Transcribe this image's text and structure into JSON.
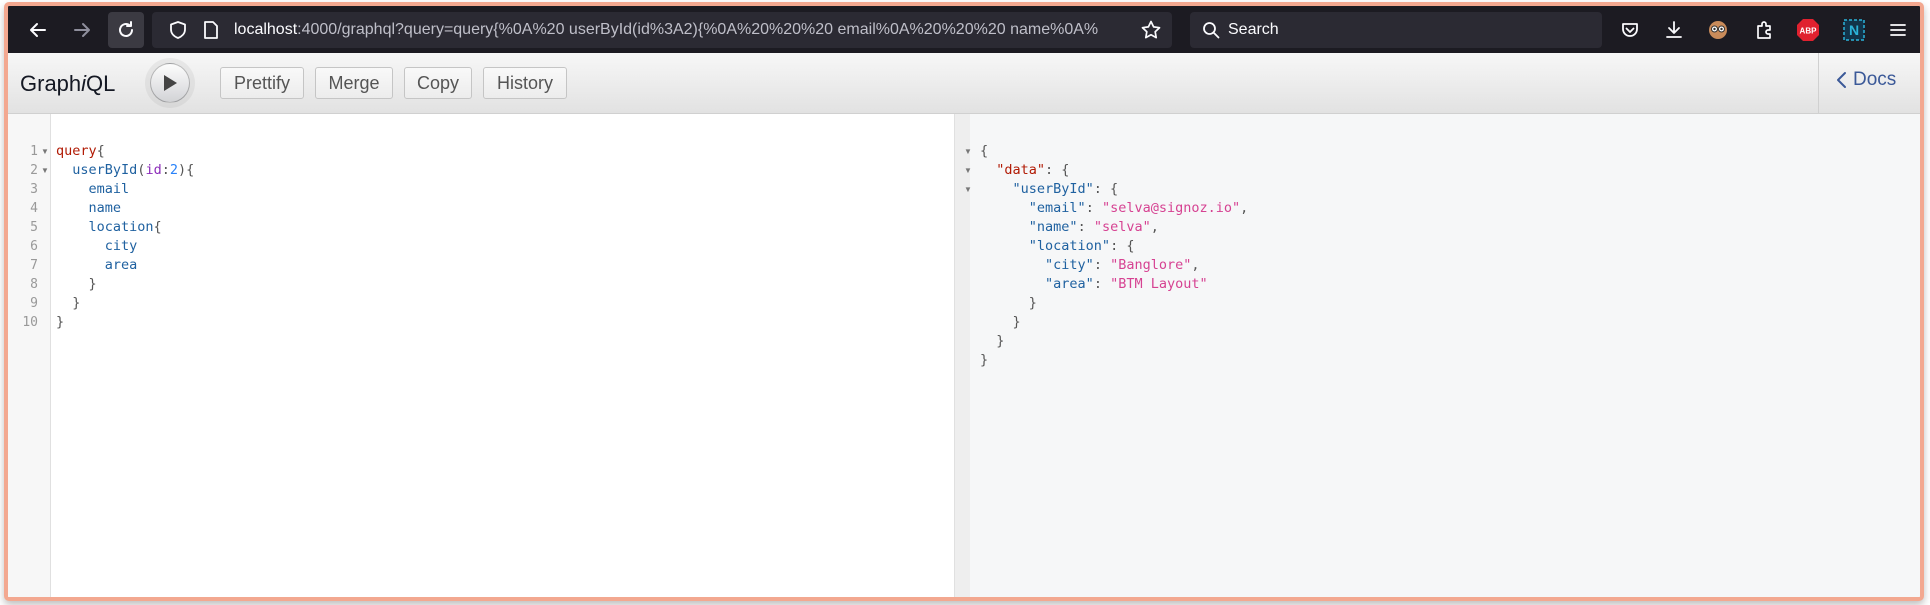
{
  "browser": {
    "url_host": "localhost",
    "url_rest": ":4000/graphql?query=query{%0A%20 userById(id%3A2){%0A%20%20%20 email%0A%20%20%20 name%0A%",
    "search_placeholder": "Search",
    "icons": [
      "back-arrow-icon",
      "forward-arrow-icon",
      "reload-icon",
      "shield-icon",
      "page-icon",
      "bookmark-star-icon",
      "search-icon",
      "pocket-icon",
      "download-icon",
      "extension-avatar-icon",
      "extensions-puzzle-icon",
      "adblock-icon",
      "n-extension-icon",
      "hamburger-menu-icon"
    ],
    "abp_label": "ABP",
    "n_label": "N"
  },
  "toolbar": {
    "title_pre": "Graph",
    "title_i": "i",
    "title_post": "QL",
    "prettify": "Prettify",
    "merge": "Merge",
    "copy": "Copy",
    "history": "History",
    "docs": "Docs"
  },
  "query_lines": [
    {
      "n": "1"
    },
    {
      "n": "2"
    },
    {
      "n": "3"
    },
    {
      "n": "4"
    },
    {
      "n": "5"
    },
    {
      "n": "6"
    },
    {
      "n": "7"
    },
    {
      "n": "8"
    },
    {
      "n": "9"
    },
    {
      "n": "10"
    }
  ],
  "query": {
    "l1_kw": "query",
    "l1_p": "{",
    "l2_field": "userById",
    "l2_p1": "(",
    "l2_arg": "id",
    "l2_p2": ":",
    "l2_val": "2",
    "l2_p3": "){",
    "l3": "email",
    "l4": "name",
    "l5_field": "location",
    "l5_p": "{",
    "l6": "city",
    "l7": "area",
    "l8": "}",
    "l9": "}",
    "l10": "}"
  },
  "result": {
    "r1": "{",
    "r2_key": "\"data\"",
    "r2_p": ": {",
    "r3_key": "\"userById\"",
    "r3_p": ": {",
    "r4_key": "\"email\"",
    "r4_p": ": ",
    "r4_val": "\"selva@signoz.io\"",
    "r4_c": ",",
    "r5_key": "\"name\"",
    "r5_p": ": ",
    "r5_val": "\"selva\"",
    "r5_c": ",",
    "r6_key": "\"location\"",
    "r6_p": ": {",
    "r7_key": "\"city\"",
    "r7_p": ": ",
    "r7_val": "\"Banglore\"",
    "r7_c": ",",
    "r8_key": "\"area\"",
    "r8_p": ": ",
    "r8_val": "\"BTM Layout\"",
    "r9": "}",
    "r10": "}",
    "r11": "}",
    "r12": "}"
  }
}
